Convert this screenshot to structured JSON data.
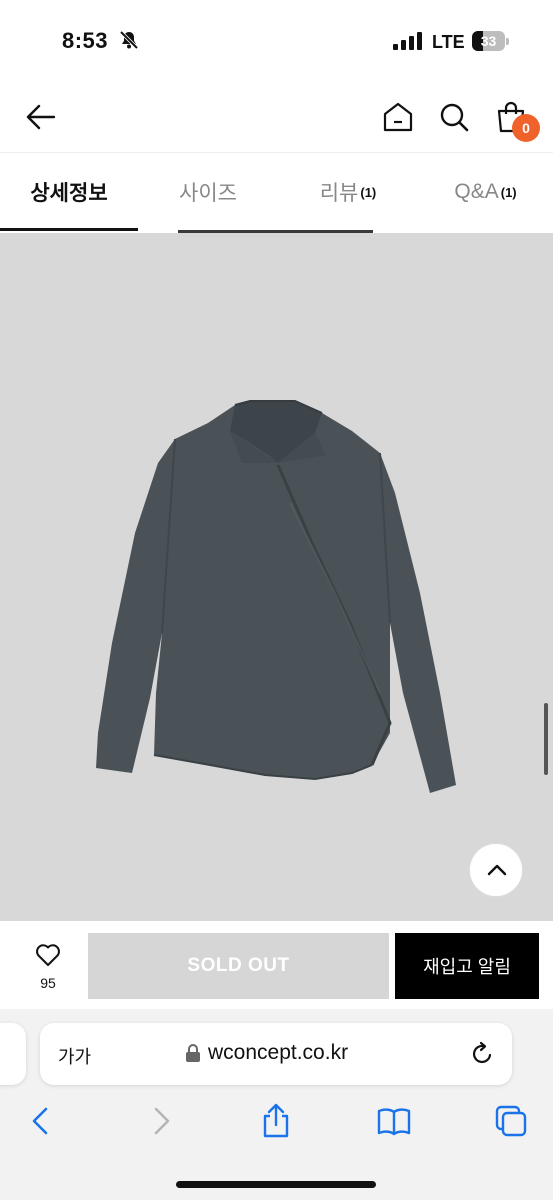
{
  "status_bar": {
    "time": "8:53",
    "network": "LTE",
    "battery": "33"
  },
  "header": {
    "cart_count": "0"
  },
  "tabs": [
    {
      "label": "상세정보",
      "count": ""
    },
    {
      "label": "사이즈",
      "count": ""
    },
    {
      "label": "리뷰",
      "count": "(1)"
    },
    {
      "label": "Q&A",
      "count": "(1)"
    }
  ],
  "purchase_bar": {
    "wish_count": "95",
    "soldout_label": "SOLD OUT",
    "restock_label": "재입고 알림"
  },
  "browser": {
    "text_size_label": "가가",
    "url": "wconcept.co.kr"
  },
  "colors": {
    "badge": "#f0622b",
    "product_background": "#d8d8d8",
    "shirt": "#4a5257",
    "soldout_button": "#d6d6d6",
    "safari_blue": "#1a73e8"
  }
}
